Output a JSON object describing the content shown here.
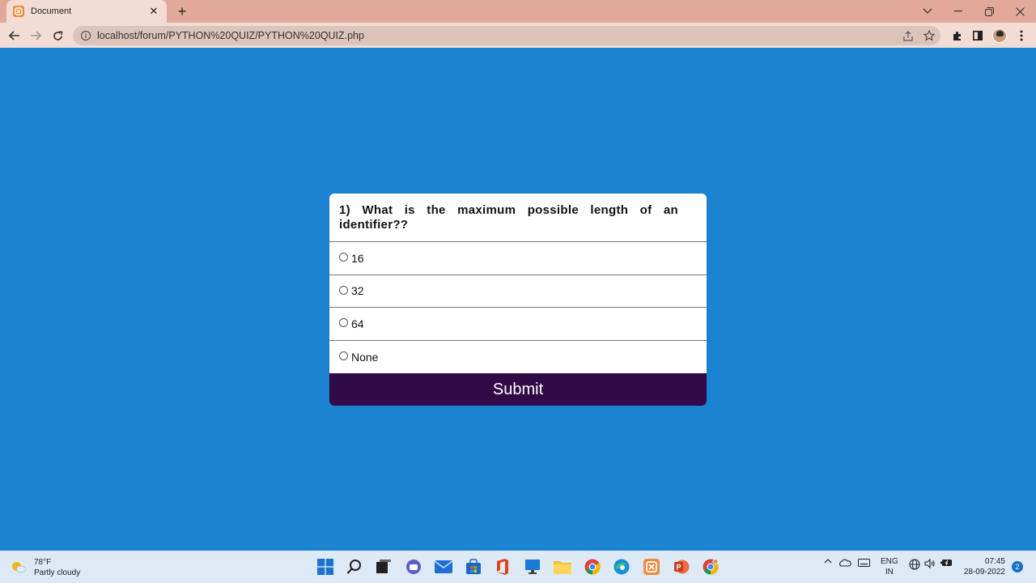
{
  "browser": {
    "tab_title": "Document",
    "tab_close": "✕",
    "new_tab": "+",
    "url": "localhost/forum/PYTHON%20QUIZ/PYTHON%20QUIZ.php",
    "icons": [
      "xampp-icon",
      "back-icon",
      "forward-icon",
      "reload-icon",
      "info-icon",
      "share-icon",
      "star-icon",
      "extensions-icon",
      "side-panel-icon",
      "profile-icon",
      "menu-icon",
      "minimize-icon",
      "restore-icon",
      "close-icon",
      "tab-search-icon"
    ]
  },
  "quiz": {
    "question": "1) What is the maximum possible length of an identifier??",
    "options": [
      "16",
      "32",
      "64",
      "None"
    ],
    "submit_label": "Submit"
  },
  "taskbar": {
    "weather_temp": "78°F",
    "weather_desc": "Partly cloudy",
    "lang_line1": "ENG",
    "lang_line2": "IN",
    "time": "07:45",
    "date": "28-09-2022",
    "notification_count": "2"
  },
  "colors": {
    "page_background": "#1b84d2",
    "submit_background": "#320a47",
    "tab_strip": "#e2a99b",
    "toolbar": "#f3dcd4"
  }
}
